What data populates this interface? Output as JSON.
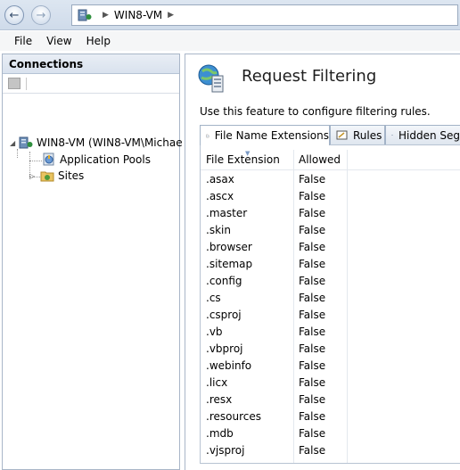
{
  "address": {
    "path": "WIN8-VM"
  },
  "menu": [
    "File",
    "View",
    "Help"
  ],
  "connections": {
    "title": "Connections",
    "server": "WIN8-VM (WIN8-VM\\Michae",
    "app_pools": "Application Pools",
    "sites": "Sites"
  },
  "feature": {
    "title": "Request Filtering",
    "description": "Use this feature to configure filtering rules."
  },
  "tabs": [
    "File Name Extensions",
    "Rules",
    "Hidden Seg"
  ],
  "grid": {
    "columns": [
      "File Extension",
      "Allowed"
    ],
    "rows": [
      [
        ".asax",
        "False"
      ],
      [
        ".ascx",
        "False"
      ],
      [
        ".master",
        "False"
      ],
      [
        ".skin",
        "False"
      ],
      [
        ".browser",
        "False"
      ],
      [
        ".sitemap",
        "False"
      ],
      [
        ".config",
        "False"
      ],
      [
        ".cs",
        "False"
      ],
      [
        ".csproj",
        "False"
      ],
      [
        ".vb",
        "False"
      ],
      [
        ".vbproj",
        "False"
      ],
      [
        ".webinfo",
        "False"
      ],
      [
        ".licx",
        "False"
      ],
      [
        ".resx",
        "False"
      ],
      [
        ".resources",
        "False"
      ],
      [
        ".mdb",
        "False"
      ],
      [
        ".vjsproj",
        "False"
      ]
    ]
  }
}
